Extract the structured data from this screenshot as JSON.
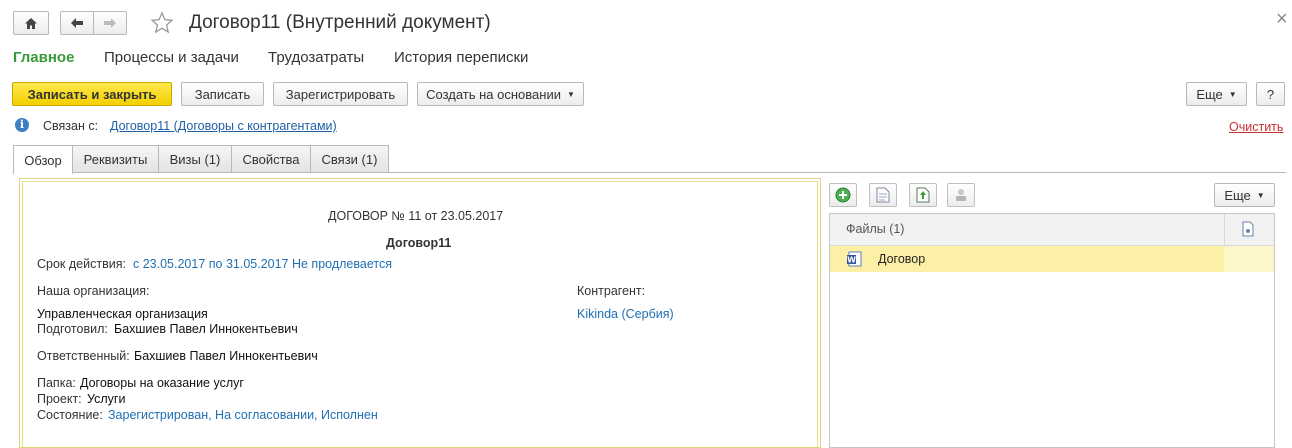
{
  "window": {
    "title": "Договор11 (Внутренний документ)",
    "close_glyph": "×"
  },
  "nav_tabs": [
    {
      "label": "Главное",
      "active": true
    },
    {
      "label": "Процессы и задачи"
    },
    {
      "label": "Трудозатраты"
    },
    {
      "label": "История переписки"
    }
  ],
  "toolbar": {
    "save_close": "Записать и закрыть",
    "save": "Записать",
    "register": "Зарегистрировать",
    "create_based": "Создать на основании",
    "more": "Еще",
    "help": "?"
  },
  "link_bar": {
    "label": "Связан с:",
    "link_text": "Договор11 (Договоры с контрагентами)",
    "clear": "Очистить"
  },
  "tabs": [
    {
      "label": "Обзор",
      "active": true
    },
    {
      "label": "Реквизиты"
    },
    {
      "label": "Визы (1)"
    },
    {
      "label": "Свойства"
    },
    {
      "label": "Связи (1)"
    }
  ],
  "document": {
    "header": "ДОГОВОР № 11 от 23.05.2017",
    "name": "Договор11",
    "validity_label": "Срок действия:",
    "validity_value": "с 23.05.2017 по 31.05.2017 Не продлевается",
    "our_org_label": "Наша организация:",
    "our_org_value": "Управленческая организация",
    "prepared_label": "Подготовил:",
    "prepared_value": "Бахшиев Павел Иннокентьевич",
    "responsible_label": "Ответственный:",
    "responsible_value": "Бахшиев Павел Иннокентьевич",
    "counterparty_label": "Контрагент:",
    "counterparty_value": "Kikinda (Сербия)",
    "folder_label": "Папка:",
    "folder_value": "Договоры на оказание услуг",
    "project_label": "Проект:",
    "project_value": "Услуги",
    "state_label": "Состояние:",
    "state_value": "Зарегистрирован, На согласовании, Исполнен"
  },
  "files": {
    "more": "Еще",
    "column_header": "Файлы (1)",
    "rows": [
      {
        "name": "Договор",
        "icon": "word-file-icon"
      }
    ]
  },
  "colors": {
    "accent_green": "#3a9a3a",
    "primary_yellow": "#f5d20f",
    "link_blue": "#1f5fa8",
    "selected_row": "#fbf0a6"
  }
}
